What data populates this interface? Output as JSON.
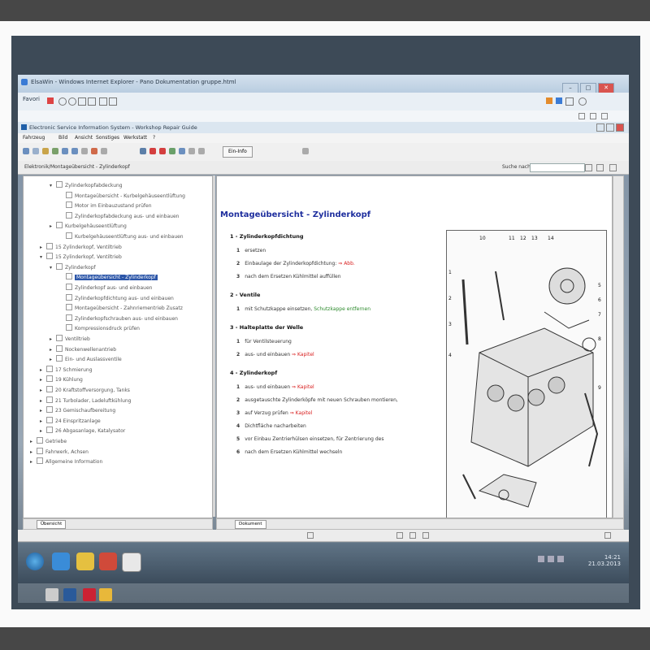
{
  "ie": {
    "title": "ElsaWin - Windows Internet Explorer - Pano Dokumentation gruppe.html",
    "tab_label": "ElsaWin",
    "favorites_label": "Favori",
    "win_min": "–",
    "win_max": "□",
    "win_close": "✕"
  },
  "app": {
    "title": "Electronic Service Information System - Workshop Repair Guide",
    "menu": [
      "Fahrzeug",
      "Bild",
      "Ansicht",
      "Sonstiges",
      "Werkstatt",
      "?"
    ],
    "toolbar_button": "Ein-Info",
    "path": "Elektronik/Montageübersicht - Zylinderkopf",
    "search_label": "Suche nach",
    "search_value": ""
  },
  "tree": {
    "items": [
      {
        "label": "Zylinderkopfabdeckung",
        "level": 1,
        "exp": "▾"
      },
      {
        "label": "Montageübersicht - Kurbelgehäuseentlüftung",
        "level": 2,
        "exp": ""
      },
      {
        "label": "Motor im Einbauzustand prüfen",
        "level": 2,
        "exp": ""
      },
      {
        "label": "Zylinderkopfabdeckung aus- und einbauen",
        "level": 2,
        "exp": ""
      },
      {
        "label": "Kurbelgehäuseentlüftung",
        "level": 1,
        "exp": "▸"
      },
      {
        "label": "Kurbelgehäuseentlüftung aus- und einbauen",
        "level": 2,
        "exp": ""
      },
      {
        "label": "15 Zylinderkopf, Ventiltrieb",
        "level": 0,
        "exp": "▸"
      },
      {
        "label": "15 Zylinderkopf, Ventiltrieb",
        "level": 0,
        "exp": "▾"
      },
      {
        "label": "Zylinderkopf",
        "level": 1,
        "exp": "▾"
      },
      {
        "label": "Montageübersicht - Zylinderkopf",
        "level": 2,
        "exp": "",
        "selected": true
      },
      {
        "label": "Zylinderkopf aus- und einbauen",
        "level": 2,
        "exp": ""
      },
      {
        "label": "Zylinderkopfdichtung aus- und einbauen",
        "level": 2,
        "exp": ""
      },
      {
        "label": "Montageübersicht - Zahnriementrieb Zusatz",
        "level": 2,
        "exp": ""
      },
      {
        "label": "Zylinderkopfschrauben aus- und einbauen",
        "level": 2,
        "exp": ""
      },
      {
        "label": "Kompressionsdruck prüfen",
        "level": 2,
        "exp": ""
      },
      {
        "label": "Ventiltrieb",
        "level": 1,
        "exp": "▸"
      },
      {
        "label": "Nockenwellenantrieb",
        "level": 1,
        "exp": "▸"
      },
      {
        "label": "Ein- und Auslassventile",
        "level": 1,
        "exp": "▸"
      },
      {
        "label": "17 Schmierung",
        "level": 0,
        "exp": "▸"
      },
      {
        "label": "19 Kühlung",
        "level": 0,
        "exp": "▸"
      },
      {
        "label": "20 Kraftstoffversorgung, Tanks",
        "level": 0,
        "exp": "▸"
      },
      {
        "label": "21 Turbolader, Ladeluftkühlung",
        "level": 0,
        "exp": "▸"
      },
      {
        "label": "23 Gemischaufbereitung",
        "level": 0,
        "exp": "▸"
      },
      {
        "label": "24 Einspritzanlage",
        "level": 0,
        "exp": "▸"
      },
      {
        "label": "26 Abgasanlage, Katalysator",
        "level": 0,
        "exp": "▸"
      },
      {
        "label": "Getriebe",
        "level": -1,
        "exp": "▸"
      },
      {
        "label": "Fahrwerk, Achsen",
        "level": -1,
        "exp": "▸"
      },
      {
        "label": "Allgemeine Information",
        "level": -1,
        "exp": "▸"
      }
    ]
  },
  "doc": {
    "title": "Montageübersicht - Zylinderkopf",
    "sections": [
      {
        "head": "1 - Zylinderkopfdichtung",
        "steps": [
          {
            "n": "1",
            "parts": [
              {
                "t": "ersetzen",
                "c": ""
              }
            ]
          },
          {
            "n": "2",
            "parts": [
              {
                "t": "Einbaulage der Zylinderkopfdichtung: ",
                "c": ""
              },
              {
                "t": "⇒ Abb.",
                "c": "red"
              }
            ]
          },
          {
            "n": "3",
            "parts": [
              {
                "t": "nach dem Ersetzen Kühlmittel auffüllen",
                "c": ""
              }
            ]
          }
        ]
      },
      {
        "head": "2 - Ventile",
        "steps": [
          {
            "n": "1",
            "parts": [
              {
                "t": "mit Schutzkappe einsetzen, ",
                "c": ""
              },
              {
                "t": "Schutzkappe entfernen",
                "c": "grn"
              }
            ]
          }
        ]
      },
      {
        "head": "3 - Halteplatte der Welle",
        "steps": [
          {
            "n": "1",
            "parts": [
              {
                "t": "für Ventilsteuerung",
                "c": ""
              }
            ]
          },
          {
            "n": "2",
            "parts": [
              {
                "t": "aus- und einbauen ",
                "c": ""
              },
              {
                "t": "⇒ Kapitel",
                "c": "red"
              }
            ]
          }
        ]
      },
      {
        "head": "4 - Zylinderkopf",
        "steps": [
          {
            "n": "1",
            "parts": [
              {
                "t": "aus- und einbauen ",
                "c": ""
              },
              {
                "t": "⇒ Kapitel",
                "c": "red"
              }
            ]
          },
          {
            "n": "2",
            "parts": [
              {
                "t": "ausgetauschte Zylinderköpfe mit neuen Schrauben montieren,",
                "c": ""
              }
            ]
          },
          {
            "n": "3",
            "parts": [
              {
                "t": "auf Verzug prüfen ",
                "c": ""
              },
              {
                "t": "⇒ Kapitel",
                "c": "red"
              }
            ]
          },
          {
            "n": "4",
            "parts": [
              {
                "t": "Dichtfläche nacharbeiten",
                "c": ""
              }
            ]
          },
          {
            "n": "5",
            "parts": [
              {
                "t": "vor Einbau Zentrierhülsen einsetzen, für Zentrierung des",
                "c": ""
              }
            ]
          },
          {
            "n": "6",
            "parts": [
              {
                "t": "nach dem Ersetzen Kühlmittel wechseln",
                "c": ""
              }
            ]
          }
        ]
      }
    ],
    "diagram_numbers": [
      "10",
      "11",
      "12",
      "13",
      "14",
      "1",
      "2",
      "3",
      "4",
      "5",
      "6",
      "7",
      "8",
      "9"
    ]
  },
  "tabs": {
    "left": "Übersicht",
    "right": "Dokument"
  },
  "taskbar": {
    "time": "14:21",
    "date": "21.03.2013"
  }
}
